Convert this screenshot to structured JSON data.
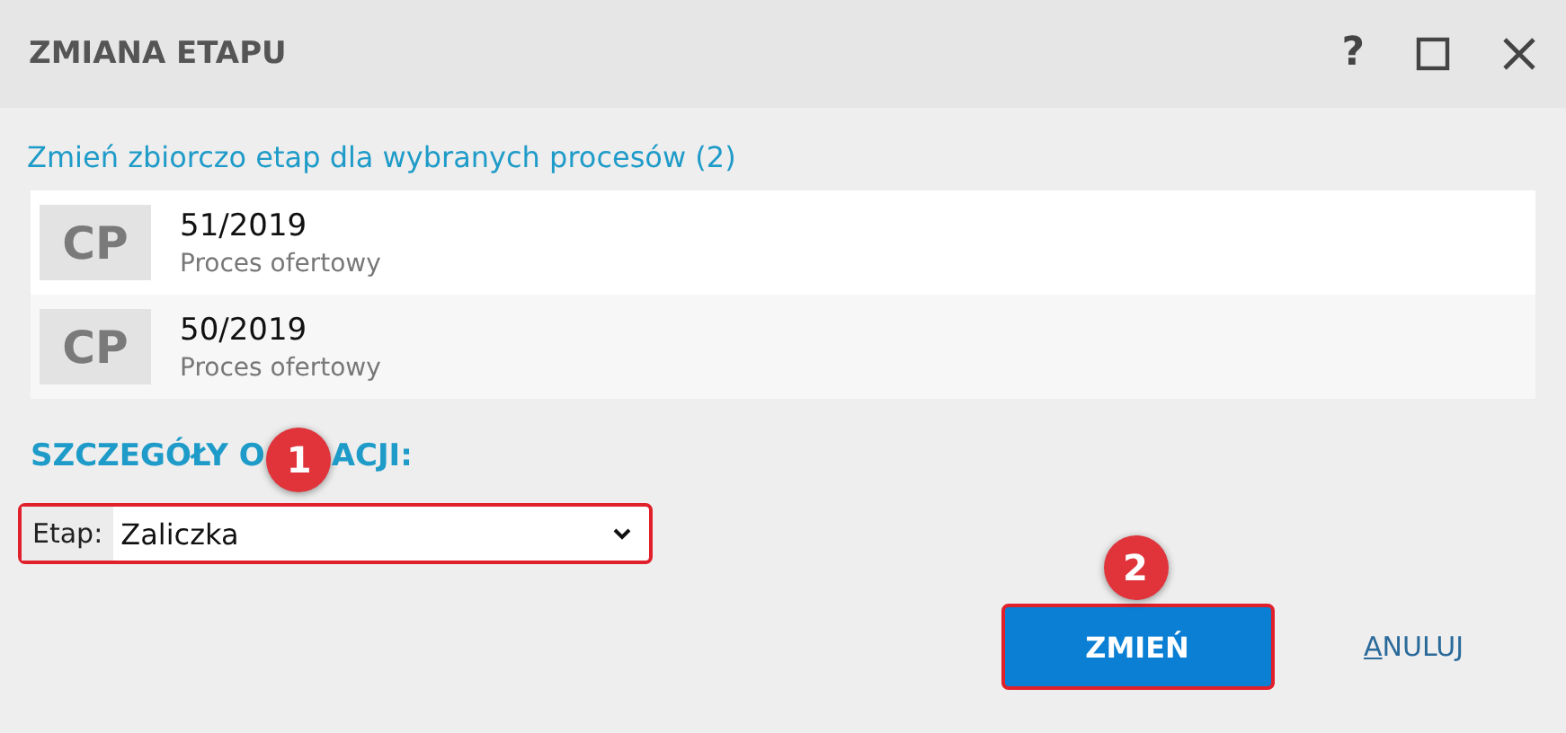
{
  "window": {
    "title": "ZMIANA ETAPU",
    "controls": [
      {
        "kind": "help",
        "label": "?"
      },
      {
        "kind": "maximize"
      },
      {
        "kind": "close"
      }
    ]
  },
  "subtitle": "Zmień zbiorczo etap dla wybranych procesów (2)",
  "processes": [
    {
      "initials": "CP",
      "number": "51/2019",
      "type": "Proces ofertowy"
    },
    {
      "initials": "CP",
      "number": "50/2019",
      "type": "Proces ofertowy"
    }
  ],
  "details": {
    "heading_parts": [
      "SZCZEGÓŁY O",
      "ACJI:"
    ],
    "field": {
      "label": "Etap:",
      "value": "Zaliczka",
      "highlighted": true,
      "badge": "1"
    }
  },
  "buttons": [
    {
      "kind": "primary",
      "label": "ZMIEŃ",
      "highlighted": true,
      "badge": "2"
    },
    {
      "kind": "link",
      "label": "ANULUJ",
      "mnemonic_underlined": true
    }
  ]
}
